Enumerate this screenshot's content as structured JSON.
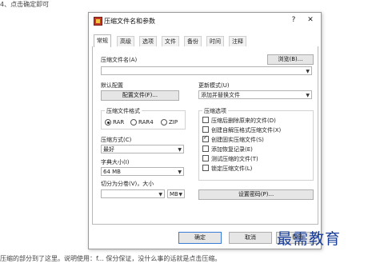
{
  "document": {
    "top_text": "4、点击确定即可",
    "bottom_text": "压缩的部分到了这里。说明使用：f... 保分保证，没什么事的话就是点击压缩。"
  },
  "dialog": {
    "title": "压缩文件名和参数",
    "help_symbol": "?",
    "close_symbol": "✕",
    "tabs": [
      "常规",
      "高级",
      "选项",
      "文件",
      "备份",
      "时间",
      "注释"
    ]
  },
  "general": {
    "archive_name_label": "压缩文件名(A)",
    "browse_button": "浏览(B)...",
    "archive_name_value": "",
    "default_profile_label": "默认配置",
    "profile_button": "配置文件(F)...",
    "update_mode_label": "更新模式(U)",
    "update_mode_value": "添加并替换文件",
    "format_group_title": "压缩文件格式",
    "formats": [
      "RAR",
      "RAR4",
      "ZIP"
    ],
    "selected_format": "RAR",
    "method_label": "压缩方式(C)",
    "method_value": "最好",
    "dict_label": "字典大小(I)",
    "dict_value": "64 MB",
    "split_label": "切分为分卷(V)，大小",
    "split_value": "",
    "split_unit": "MB",
    "options_group_title": "压缩选项",
    "options": [
      {
        "label": "压缩后删除原来的文件(D)",
        "checked": false
      },
      {
        "label": "创建自解压格式压缩文件(X)",
        "checked": false
      },
      {
        "label": "创建固实压缩文件(S)",
        "checked": true
      },
      {
        "label": "添加恢复记录(E)",
        "checked": false
      },
      {
        "label": "测试压缩的文件(T)",
        "checked": false
      },
      {
        "label": "锁定压缩文件(L)",
        "checked": false
      }
    ],
    "password_button": "设置密码(P)..."
  },
  "footer": {
    "ok": "确定",
    "cancel": "取消",
    "help": "帮助"
  },
  "watermark": "最需教育"
}
